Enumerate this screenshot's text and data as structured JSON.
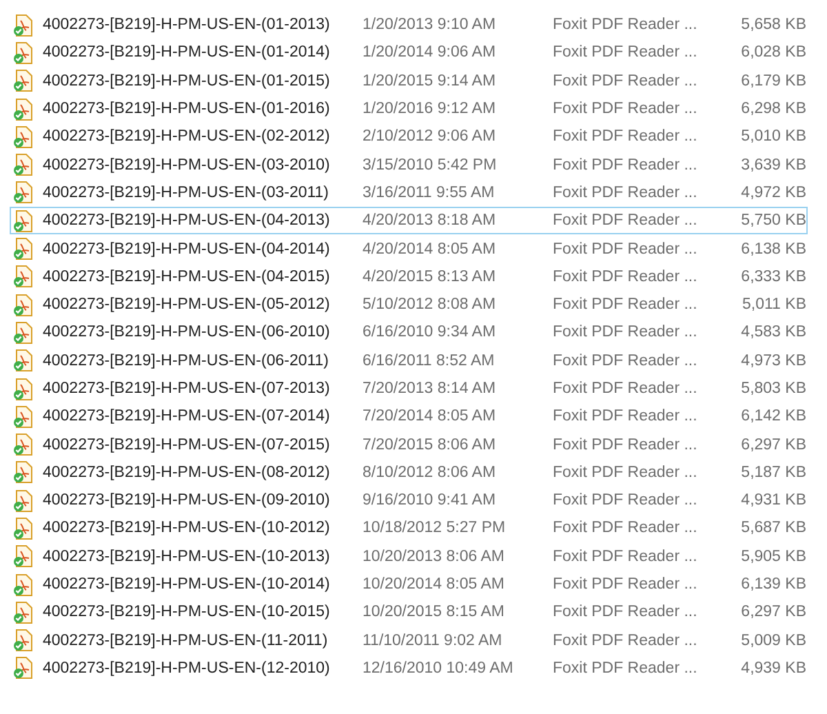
{
  "files": [
    {
      "name": "4002273-[B219]-H-PM-US-EN-(01-2013)",
      "date": "1/20/2013 9:10 AM",
      "type": "Foxit PDF Reader ...",
      "size": "5,658 KB",
      "selected": false
    },
    {
      "name": "4002273-[B219]-H-PM-US-EN-(01-2014)",
      "date": "1/20/2014 9:06 AM",
      "type": "Foxit PDF Reader ...",
      "size": "6,028 KB",
      "selected": false
    },
    {
      "name": "4002273-[B219]-H-PM-US-EN-(01-2015)",
      "date": "1/20/2015 9:14 AM",
      "type": "Foxit PDF Reader ...",
      "size": "6,179 KB",
      "selected": false
    },
    {
      "name": "4002273-[B219]-H-PM-US-EN-(01-2016)",
      "date": "1/20/2016 9:12 AM",
      "type": "Foxit PDF Reader ...",
      "size": "6,298 KB",
      "selected": false
    },
    {
      "name": "4002273-[B219]-H-PM-US-EN-(02-2012)",
      "date": "2/10/2012 9:06 AM",
      "type": "Foxit PDF Reader ...",
      "size": "5,010 KB",
      "selected": false
    },
    {
      "name": "4002273-[B219]-H-PM-US-EN-(03-2010)",
      "date": "3/15/2010 5:42 PM",
      "type": "Foxit PDF Reader ...",
      "size": "3,639 KB",
      "selected": false
    },
    {
      "name": "4002273-[B219]-H-PM-US-EN-(03-2011)",
      "date": "3/16/2011 9:55 AM",
      "type": "Foxit PDF Reader ...",
      "size": "4,972 KB",
      "selected": false
    },
    {
      "name": "4002273-[B219]-H-PM-US-EN-(04-2013)",
      "date": "4/20/2013 8:18 AM",
      "type": "Foxit PDF Reader ...",
      "size": "5,750 KB",
      "selected": true
    },
    {
      "name": "4002273-[B219]-H-PM-US-EN-(04-2014)",
      "date": "4/20/2014 8:05 AM",
      "type": "Foxit PDF Reader ...",
      "size": "6,138 KB",
      "selected": false
    },
    {
      "name": "4002273-[B219]-H-PM-US-EN-(04-2015)",
      "date": "4/20/2015 8:13 AM",
      "type": "Foxit PDF Reader ...",
      "size": "6,333 KB",
      "selected": false
    },
    {
      "name": "4002273-[B219]-H-PM-US-EN-(05-2012)",
      "date": "5/10/2012 8:08 AM",
      "type": "Foxit PDF Reader ...",
      "size": "5,011 KB",
      "selected": false
    },
    {
      "name": "4002273-[B219]-H-PM-US-EN-(06-2010)",
      "date": "6/16/2010 9:34 AM",
      "type": "Foxit PDF Reader ...",
      "size": "4,583 KB",
      "selected": false
    },
    {
      "name": "4002273-[B219]-H-PM-US-EN-(06-2011)",
      "date": "6/16/2011 8:52 AM",
      "type": "Foxit PDF Reader ...",
      "size": "4,973 KB",
      "selected": false
    },
    {
      "name": "4002273-[B219]-H-PM-US-EN-(07-2013)",
      "date": "7/20/2013 8:14 AM",
      "type": "Foxit PDF Reader ...",
      "size": "5,803 KB",
      "selected": false
    },
    {
      "name": "4002273-[B219]-H-PM-US-EN-(07-2014)",
      "date": "7/20/2014 8:05 AM",
      "type": "Foxit PDF Reader ...",
      "size": "6,142 KB",
      "selected": false
    },
    {
      "name": "4002273-[B219]-H-PM-US-EN-(07-2015)",
      "date": "7/20/2015 8:06 AM",
      "type": "Foxit PDF Reader ...",
      "size": "6,297 KB",
      "selected": false
    },
    {
      "name": "4002273-[B219]-H-PM-US-EN-(08-2012)",
      "date": "8/10/2012 8:06 AM",
      "type": "Foxit PDF Reader ...",
      "size": "5,187 KB",
      "selected": false
    },
    {
      "name": "4002273-[B219]-H-PM-US-EN-(09-2010)",
      "date": "9/16/2010 9:41 AM",
      "type": "Foxit PDF Reader ...",
      "size": "4,931 KB",
      "selected": false
    },
    {
      "name": "4002273-[B219]-H-PM-US-EN-(10-2012)",
      "date": "10/18/2012 5:27 PM",
      "type": "Foxit PDF Reader ...",
      "size": "5,687 KB",
      "selected": false
    },
    {
      "name": "4002273-[B219]-H-PM-US-EN-(10-2013)",
      "date": "10/20/2013 8:06 AM",
      "type": "Foxit PDF Reader ...",
      "size": "5,905 KB",
      "selected": false
    },
    {
      "name": "4002273-[B219]-H-PM-US-EN-(10-2014)",
      "date": "10/20/2014 8:05 AM",
      "type": "Foxit PDF Reader ...",
      "size": "6,139 KB",
      "selected": false
    },
    {
      "name": "4002273-[B219]-H-PM-US-EN-(10-2015)",
      "date": "10/20/2015 8:15 AM",
      "type": "Foxit PDF Reader ...",
      "size": "6,297 KB",
      "selected": false
    },
    {
      "name": "4002273-[B219]-H-PM-US-EN-(11-2011)",
      "date": "11/10/2011 9:02 AM",
      "type": "Foxit PDF Reader ...",
      "size": "5,009 KB",
      "selected": false
    },
    {
      "name": "4002273-[B219]-H-PM-US-EN-(12-2010)",
      "date": "12/16/2010 10:49 AM",
      "type": "Foxit PDF Reader ...",
      "size": "4,939 KB",
      "selected": false
    }
  ]
}
